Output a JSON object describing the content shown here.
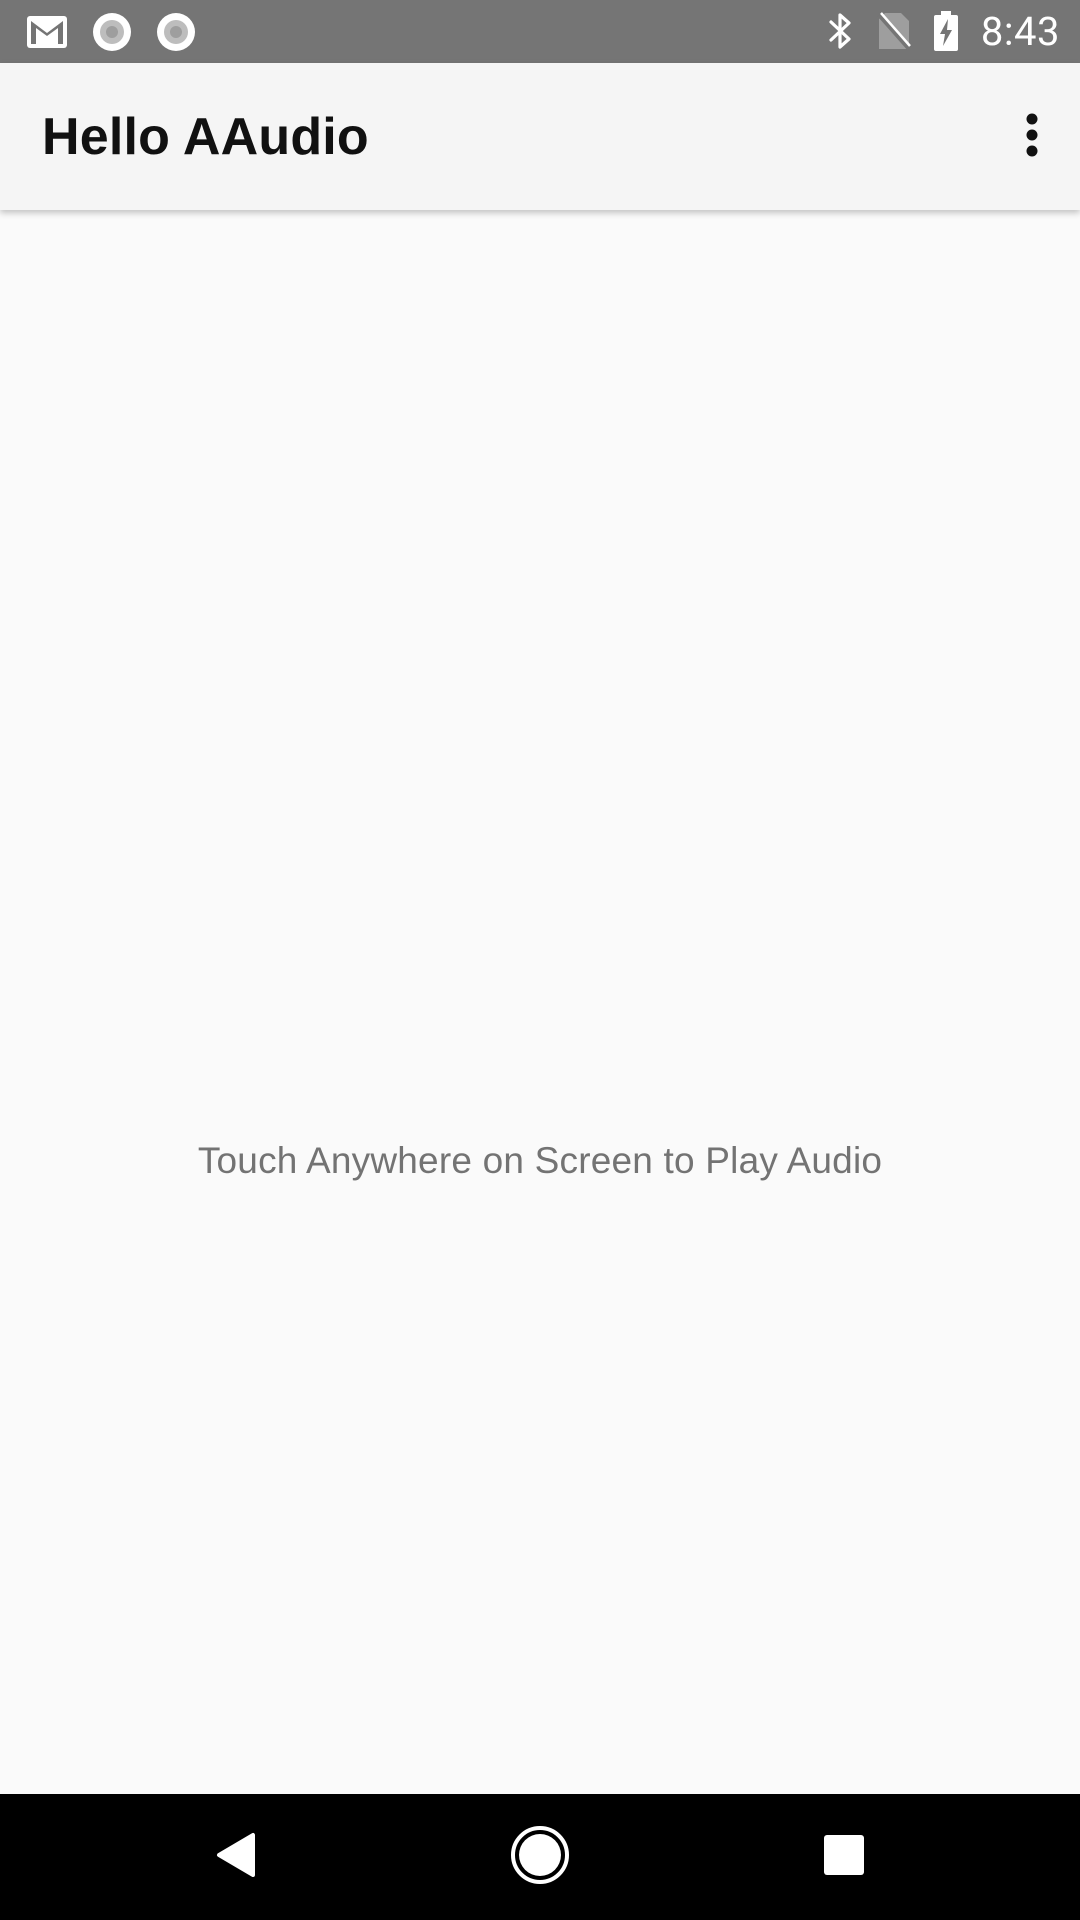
{
  "status_bar": {
    "time": "8:43",
    "left_icons": [
      "gmail-icon",
      "notification-dot-icon",
      "notification-dot-icon"
    ],
    "right_icons": [
      "bluetooth-icon",
      "no-sim-icon",
      "battery-charging-icon"
    ]
  },
  "app_bar": {
    "title": "Hello AAudio",
    "overflow_icon": "more-vert-icon"
  },
  "content": {
    "hint": "Touch Anywhere on Screen to Play Audio"
  },
  "nav_bar": {
    "buttons": [
      "back-icon",
      "home-icon",
      "recents-icon"
    ]
  },
  "colors": {
    "status_bar": "#757575",
    "app_bar": "#f5f5f5",
    "background": "#fafafa",
    "hint_text": "#737373",
    "nav_bar": "#000000"
  }
}
